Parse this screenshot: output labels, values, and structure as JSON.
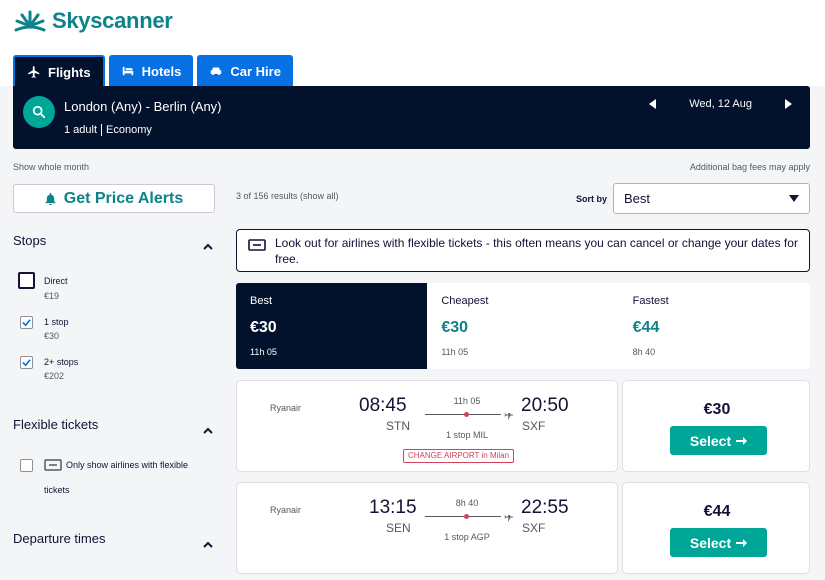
{
  "brand": {
    "name": "Skyscanner",
    "color": "#0c838a"
  },
  "tabs": [
    {
      "label": "Flights",
      "icon": "plane-icon",
      "active": true
    },
    {
      "label": "Hotels",
      "icon": "bed-icon",
      "active": false
    },
    {
      "label": "Car Hire",
      "icon": "car-icon",
      "active": false
    }
  ],
  "search": {
    "route": "London (Any) - Berlin (Any)",
    "adults": "1 adult",
    "cabin": "Economy",
    "date": "Wed, 12 Aug"
  },
  "links": {
    "whole_month": "Show whole month",
    "bag_fees": "Additional bag fees may apply"
  },
  "price_alerts_label": "Get Price Alerts",
  "filters": {
    "stops": {
      "title": "Stops",
      "options": [
        {
          "label": "Direct",
          "price": "€19",
          "checked": false
        },
        {
          "label": "1 stop",
          "price": "€30",
          "checked": true
        },
        {
          "label": "2+ stops",
          "price": "€202",
          "checked": true
        }
      ]
    },
    "flexible": {
      "title": "Flexible tickets",
      "line1": "Only show airlines with flexible",
      "line2": "tickets"
    },
    "departure": {
      "title": "Departure times"
    }
  },
  "results": {
    "count": "3 of 156 results (show all)",
    "sort_label": "Sort by",
    "sort_value": "Best"
  },
  "notice": {
    "text": "Look out for airlines with flexible tickets - this often means you can cancel or change your dates for free."
  },
  "sort_tabs": [
    {
      "name": "Best",
      "price": "€30",
      "duration": "11h 05",
      "active": true
    },
    {
      "name": "Cheapest",
      "price": "€30",
      "duration": "11h 05",
      "active": false
    },
    {
      "name": "Fastest",
      "price": "€44",
      "duration": "8h 40",
      "active": false
    }
  ],
  "itineraries": [
    {
      "airline": "Ryanair",
      "depart_time": "08:45",
      "depart_airport": "STN",
      "arrive_time": "20:50",
      "arrive_airport": "SXF",
      "duration": "11h 05",
      "stops_prefix": "1 stop ",
      "stops_airport": "MIL",
      "warning": "CHANGE AIRPORT in Milan",
      "price": "€30",
      "select_label": "Select"
    },
    {
      "airline": "Ryanair",
      "depart_time": "13:15",
      "depart_airport": "SEN",
      "arrive_time": "22:55",
      "arrive_airport": "SXF",
      "duration": "8h 40",
      "stops_prefix": "1 stop ",
      "stops_airport": "AGP",
      "price": "€44",
      "select_label": "Select"
    }
  ]
}
